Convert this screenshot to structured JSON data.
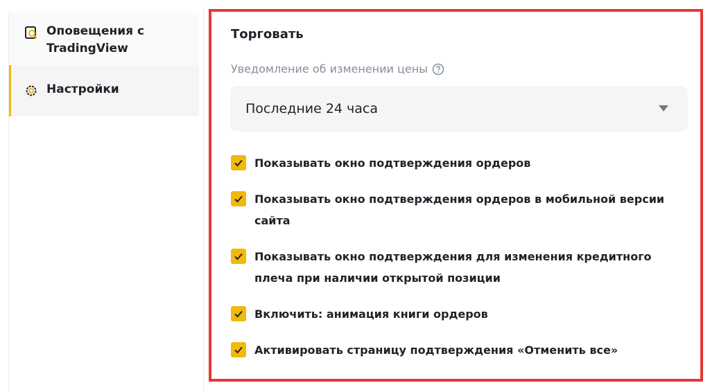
{
  "sidebar": {
    "items": [
      {
        "label": "Оповещения с TradingView",
        "icon": "tradingview-alert-icon"
      },
      {
        "label": "Настройки",
        "icon": "gear-icon",
        "active": true
      }
    ]
  },
  "main": {
    "section_title": "Торговать",
    "price_notification": {
      "label": "Уведомление об изменении цены",
      "selected": "Последние 24 часа"
    },
    "options": [
      {
        "label": "Показывать окно подтверждения ордеров",
        "checked": true
      },
      {
        "label": "Показывать окно подтверждения ордеров в мобильной версии сайта",
        "checked": true
      },
      {
        "label": "Показывать окно подтверждения для изменения кредитного плеча при наличии открытой позиции",
        "checked": true
      },
      {
        "label": "Включить: анимация книги ордеров",
        "checked": true
      },
      {
        "label": "Активировать страницу подтверждения «Отменить все»",
        "checked": true
      }
    ]
  },
  "colors": {
    "accent": "#f0b90b",
    "highlight_border": "#e53935",
    "muted_text": "#848e9c"
  }
}
